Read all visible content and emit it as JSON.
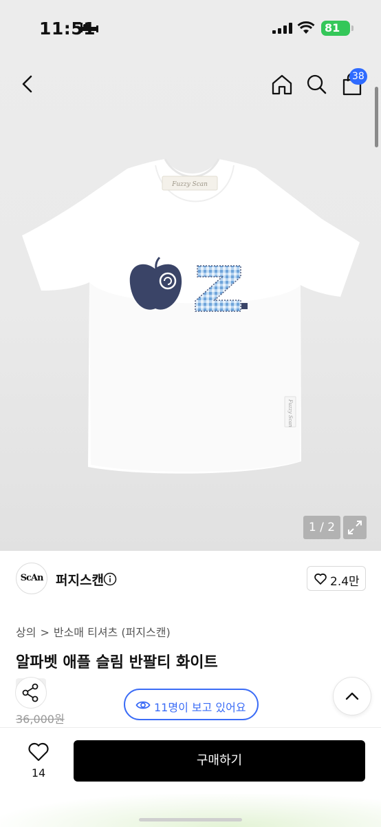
{
  "status_bar": {
    "time": "11:51",
    "battery": "81"
  },
  "header": {
    "cart_count": "38"
  },
  "gallery": {
    "counter": "1 / 2",
    "tag_text": "Fuzzy Scan",
    "side_tag_text": "Fuzzy Scan"
  },
  "brand": {
    "logo_text": "ScAn",
    "name": "퍼지스캔",
    "likes": "2.4만"
  },
  "breadcrumb": {
    "category": "상의",
    "separator": ">",
    "subcategory": "반소매 티셔츠 (퍼지스캔)"
  },
  "product": {
    "title": "알파벳 애플 슬림 반팔티 화이트",
    "original_price": "36,000원"
  },
  "viewers": {
    "text": "11명이 보고 있어요"
  },
  "bottom_bar": {
    "wish_count": "14",
    "buy_label": "구매하기"
  },
  "colors": {
    "accent_blue": "#3b6cf6",
    "badge_blue": "#2f6bff",
    "navy_print": "#3a4467",
    "gingham": "#8ebbe8",
    "buy_button": "#000000"
  },
  "icons": [
    "bed-icon",
    "signal-icon",
    "wifi-icon",
    "back-icon",
    "home-icon",
    "search-icon",
    "shopping-bag-icon",
    "expand-icon",
    "info-icon",
    "heart-icon",
    "share-icon",
    "eye-icon",
    "chevron-up-icon"
  ]
}
